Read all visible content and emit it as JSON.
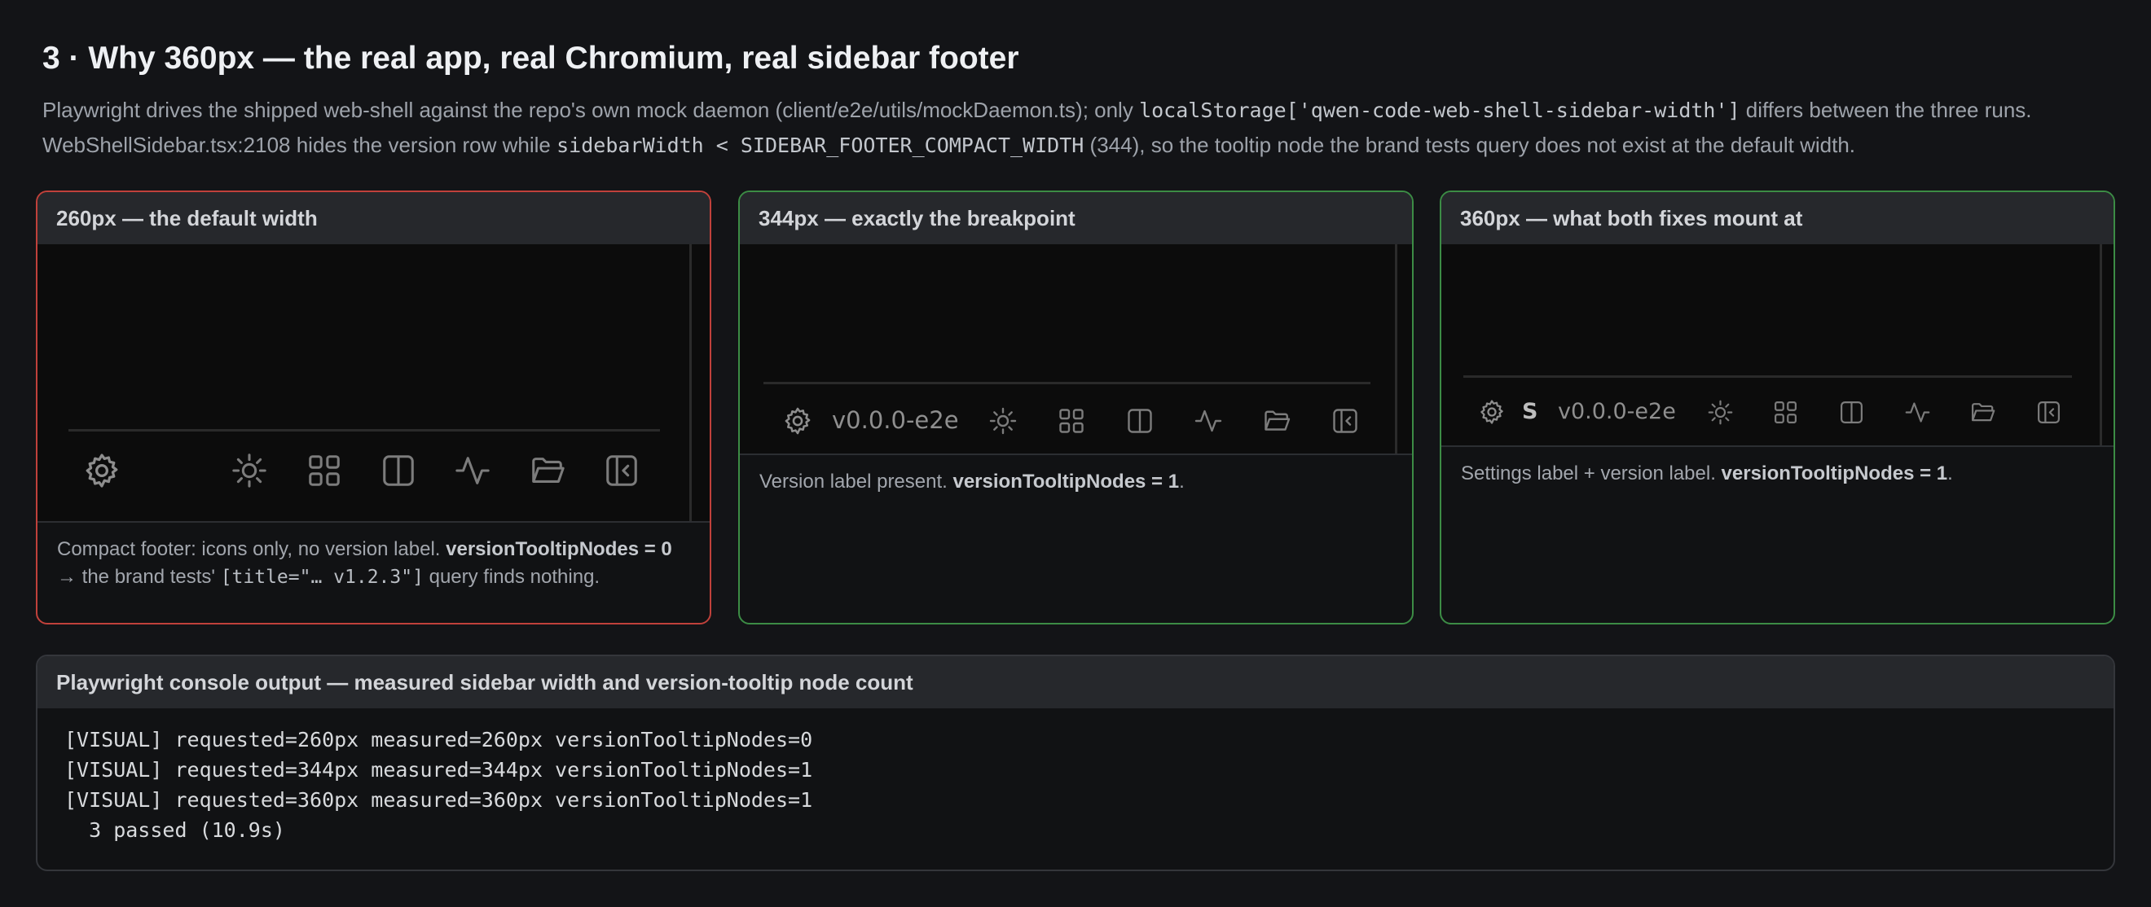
{
  "header": {
    "title": "3 · Why 360px — the real app, real Chromium, real sidebar footer",
    "line1_a": "Playwright drives the shipped web-shell against the repo's own mock daemon (client/e2e/utils/mockDaemon.ts); only ",
    "line1_code": "localStorage['qwen-code-web-shell-sidebar-width']",
    "line1_b": " differs between the three runs.",
    "line2_a": "WebShellSidebar.tsx:2108 hides the version row while ",
    "line2_code": "sidebarWidth < SIDEBAR_FOOTER_COMPACT_WIDTH",
    "line2_b": " (344), so the tooltip node the brand tests query does not exist at the default width."
  },
  "panels": [
    {
      "title": "260px — the default width",
      "status": "fail",
      "border_color": "#c0413b",
      "caption_a": "Compact footer: icons only, no version label. ",
      "caption_bold": "versionTooltipNodes = 0",
      "caption_b": "→ the brand tests' ",
      "caption_code": "[title=\"… v1.2.3\"]",
      "caption_c": " query finds nothing."
    },
    {
      "title": "344px — exactly the breakpoint",
      "status": "pass",
      "border_color": "#3c8c45",
      "version_label": "v0.0.0-e2e",
      "caption_a": "Version label present. ",
      "caption_bold": "versionTooltipNodes = 1",
      "caption_b": "."
    },
    {
      "title": "360px — what both fixes mount at",
      "status": "pass",
      "border_color": "#3c8c45",
      "settings_label": "S",
      "version_label": "v0.0.0-e2e",
      "caption_a": "Settings label + version label. ",
      "caption_bold": "versionTooltipNodes = 1",
      "caption_b": "."
    }
  ],
  "footer_icons": [
    "gear-icon",
    "sun-icon",
    "grid-icon",
    "columns-icon",
    "activity-icon",
    "folder-icon",
    "collapse-sidebar-icon"
  ],
  "console": {
    "title": "Playwright console output — measured sidebar width and version-tooltip node count",
    "lines": [
      "[VISUAL] requested=260px measured=260px versionTooltipNodes=0",
      "[VISUAL] requested=344px measured=344px versionTooltipNodes=1",
      "[VISUAL] requested=360px measured=360px versionTooltipNodes=1",
      "  3 passed (10.9s)"
    ]
  }
}
